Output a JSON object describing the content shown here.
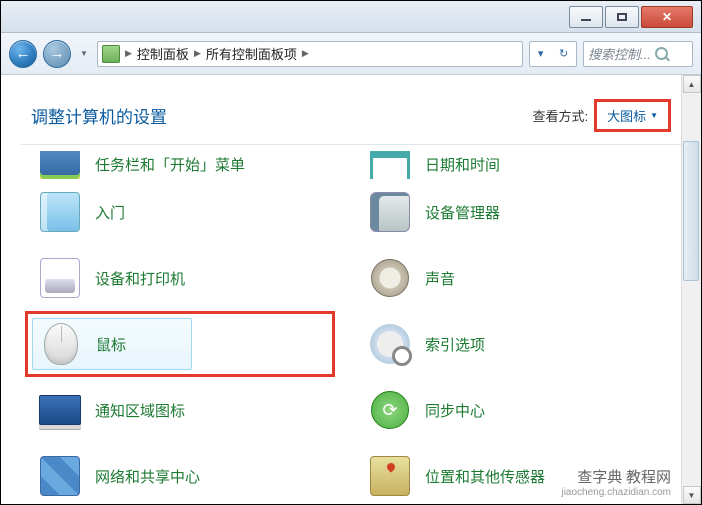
{
  "breadcrumb": {
    "item1": "控制面板",
    "item2": "所有控制面板项"
  },
  "search": {
    "placeholder": "搜索控制..."
  },
  "page_title": "调整计算机的设置",
  "view": {
    "label": "查看方式:",
    "value": "大图标"
  },
  "items": {
    "taskbar": "任务栏和「开始」菜单",
    "date": "日期和时间",
    "getting_started": "入门",
    "device_manager": "设备管理器",
    "devices_printers": "设备和打印机",
    "sound": "声音",
    "mouse": "鼠标",
    "indexing": "索引选项",
    "notification": "通知区域图标",
    "sync": "同步中心",
    "network": "网络和共享中心",
    "location": "位置和其他传感器"
  },
  "watermark": {
    "line1": "查字典 教程网",
    "line2": "jiaocheng.chazidian.com"
  }
}
